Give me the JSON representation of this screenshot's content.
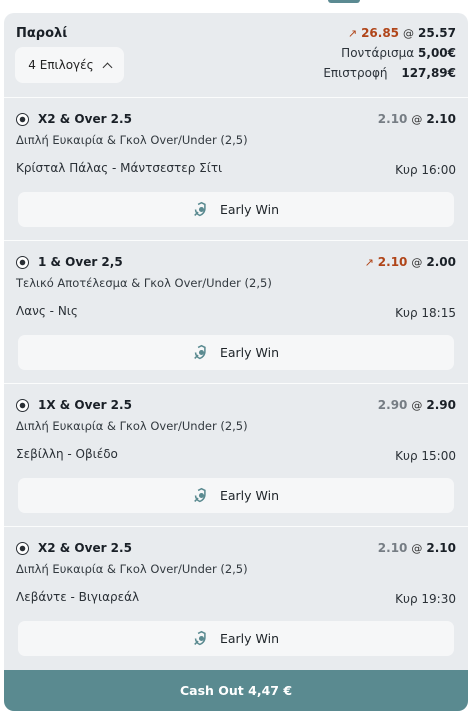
{
  "colors": {
    "accent": "#5a8a90",
    "progress": "#f0a21c",
    "trend_up": "#b04519"
  },
  "header": {
    "title": "Παρολί",
    "selections_label": "4 Επιλογές",
    "old_odds": "26.85",
    "at": "@",
    "current_odds": "25.57",
    "stake_label": "Ποντάρισμα",
    "stake_value": "5,00€",
    "return_label": "Επιστροφή",
    "return_value": "127,89€"
  },
  "selections": [
    {
      "market": "X2 & Over 2.5",
      "old_odds": "2.10",
      "at": "@",
      "odds": "2.10",
      "trend": false,
      "market_type": "Διπλή Ευκαιρία & Γκολ Over/Under (2,5)",
      "match": "Κρίσταλ Πάλας - Μάντσεστερ Σίτι",
      "kickoff": "Κυρ 16:00",
      "early_win": "Early Win"
    },
    {
      "market": "1 & Over 2,5",
      "old_odds": "2.10",
      "at": "@",
      "odds": "2.00",
      "trend": true,
      "market_type": "Τελικό Αποτέλεσμα & Γκολ Over/Under (2,5)",
      "match": "Λανς - Νις",
      "kickoff": "Κυρ 18:15",
      "early_win": "Early Win"
    },
    {
      "market": "1X & Over 2.5",
      "old_odds": "2.90",
      "at": "@",
      "odds": "2.90",
      "trend": false,
      "market_type": "Διπλή Ευκαιρία & Γκολ Over/Under (2,5)",
      "match": "Σεβίλλη - Οβιέδο",
      "kickoff": "Κυρ 15:00",
      "early_win": "Early Win"
    },
    {
      "market": "X2 & Over 2.5",
      "old_odds": "2.10",
      "at": "@",
      "odds": "2.10",
      "trend": false,
      "market_type": "Διπλή Ευκαιρία & Γκολ Over/Under (2,5)",
      "match": "Λεβάντε - Βιγιαρεάλ",
      "kickoff": "Κυρ 19:30",
      "early_win": "Early Win"
    }
  ],
  "cashout": {
    "label": "Cash Out 4,47 €",
    "progress": 0.45
  },
  "icons": {
    "sport": "soccer-ball-icon",
    "early_win": "early-win-icon",
    "trend": "trend-up-icon",
    "chevron": "chevron-up-icon"
  }
}
